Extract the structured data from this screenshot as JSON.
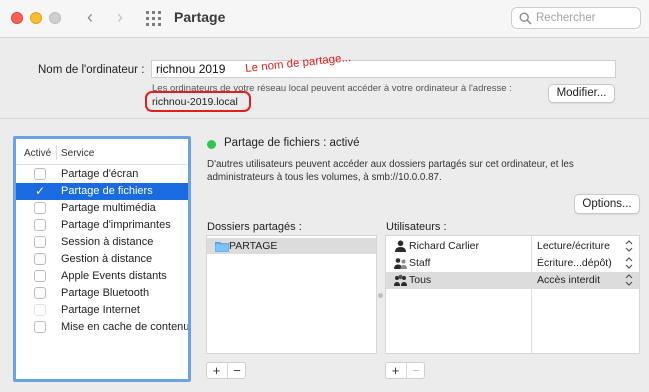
{
  "window": {
    "title": "Partage",
    "search_placeholder": "Rechercher"
  },
  "computer": {
    "name_label": "Nom de l'ordinateur :",
    "name_value": "richnou 2019",
    "note": "Les ordinateurs de votre réseau local peuvent accéder à votre ordinateur à l'adresse :",
    "local_address": "richnou-2019.local",
    "modify_button": "Modifier...",
    "annotation": "Le nom de partage..."
  },
  "service_list": {
    "header_active": "Activé",
    "header_service": "Service",
    "items": [
      {
        "label": "Partage d'écran",
        "checked": false,
        "selected": false
      },
      {
        "label": "Partage de fichiers",
        "checked": true,
        "selected": true
      },
      {
        "label": "Partage multimédia",
        "checked": false,
        "selected": false
      },
      {
        "label": "Partage d'imprimantes",
        "checked": false,
        "selected": false
      },
      {
        "label": "Session à distance",
        "checked": false,
        "selected": false
      },
      {
        "label": "Gestion à distance",
        "checked": false,
        "selected": false
      },
      {
        "label": "Apple Events distants",
        "checked": false,
        "selected": false
      },
      {
        "label": "Partage Bluetooth",
        "checked": false,
        "selected": false
      },
      {
        "label": "Partage Internet",
        "checked": false,
        "selected": false,
        "dim": true
      },
      {
        "label": "Mise en cache de contenu",
        "checked": false,
        "selected": false
      }
    ]
  },
  "status": {
    "text": "Partage de fichiers : activé",
    "color": "#2fc552",
    "description": "D'autres utilisateurs peuvent accéder aux dossiers partagés sur cet ordinateur, et les administrateurs à tous les volumes, à smb://10.0.0.87.",
    "options_button": "Options..."
  },
  "shared_folders": {
    "label": "Dossiers partagés :",
    "items": [
      {
        "name": "PARTAGE",
        "icon": "folder-icon"
      }
    ]
  },
  "users": {
    "label": "Utilisateurs :",
    "items": [
      {
        "name": "Richard Carlier",
        "permission": "Lecture/écriture",
        "icon": "user-icon"
      },
      {
        "name": "Staff",
        "permission": "Écriture...dépôt)",
        "icon": "group-icon"
      },
      {
        "name": "Tous",
        "permission": "Accès interdit",
        "icon": "everyone-icon",
        "selected": true
      }
    ]
  },
  "buttons": {
    "plus": "+",
    "minus": "−"
  },
  "colors": {
    "accent": "#1a6ae0",
    "annotation": "#e0201e",
    "focus_ring": "#6ba2e6"
  }
}
